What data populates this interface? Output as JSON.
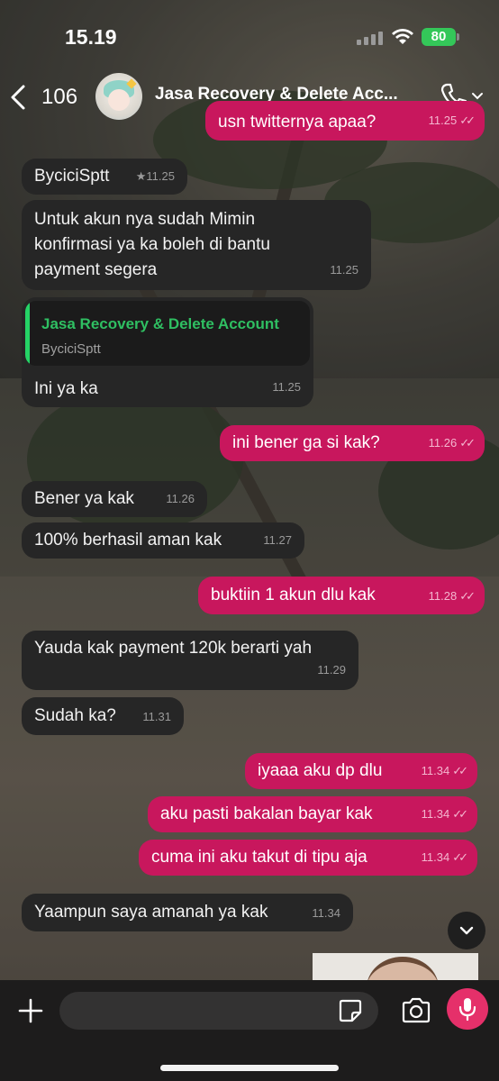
{
  "status_bar": {
    "time": "15.19",
    "battery": "80"
  },
  "header": {
    "back_count": "106",
    "title": "Jasa Recovery & Delete Acc..."
  },
  "messages": [
    {
      "dir": "out",
      "text": "usn twitternya apaa?",
      "time": "11.25",
      "read": true
    },
    {
      "dir": "in",
      "text": "ByciciSptt",
      "time": "★11.25"
    },
    {
      "dir": "in",
      "lines": [
        "Untuk akun nya sudah Mimin",
        "konfirmasi ya ka boleh di bantu",
        "payment segera"
      ],
      "time": "11.25"
    },
    {
      "dir": "in",
      "reply": {
        "title": "Jasa Recovery & Delete Account",
        "text": "ByciciSptt"
      },
      "text": "Ini ya ka",
      "time": "11.25"
    },
    {
      "dir": "out",
      "text": "ini bener ga si kak?",
      "time": "11.26",
      "read": true
    },
    {
      "dir": "in",
      "text": "Bener ya kak",
      "time": "11.26"
    },
    {
      "dir": "in",
      "text": "100% berhasil aman kak",
      "time": "11.27"
    },
    {
      "dir": "out",
      "text": "buktiin 1 akun dlu kak",
      "time": "11.28",
      "read": true
    },
    {
      "dir": "in",
      "text": "Yauda kak payment 120k berarti yah",
      "time": "11.29"
    },
    {
      "dir": "in",
      "text": "Sudah ka?",
      "time": "11.31"
    },
    {
      "dir": "out",
      "text": "iyaaa aku dp dlu",
      "time": "11.34",
      "read": true
    },
    {
      "dir": "out",
      "text": "aku pasti bakalan bayar kak",
      "time": "11.34",
      "read": true
    },
    {
      "dir": "out",
      "text": "cuma ini aku takut di tipu aja",
      "time": "11.34",
      "read": true
    },
    {
      "dir": "in",
      "text": "Yaampun saya amanah ya kak",
      "time": "11.34"
    }
  ],
  "icons": {
    "back": "chevron-left-icon",
    "call": "phone-icon",
    "scroll": "chevron-down-icon",
    "attach": "plus-icon",
    "sticker": "sticker-icon",
    "camera": "camera-icon",
    "mic": "microphone-icon"
  },
  "colors": {
    "outgoing": "#c8175d",
    "incoming": "#262626",
    "reply_accent": "#25d366",
    "mic_button": "#e5306a",
    "battery": "#34c759"
  }
}
